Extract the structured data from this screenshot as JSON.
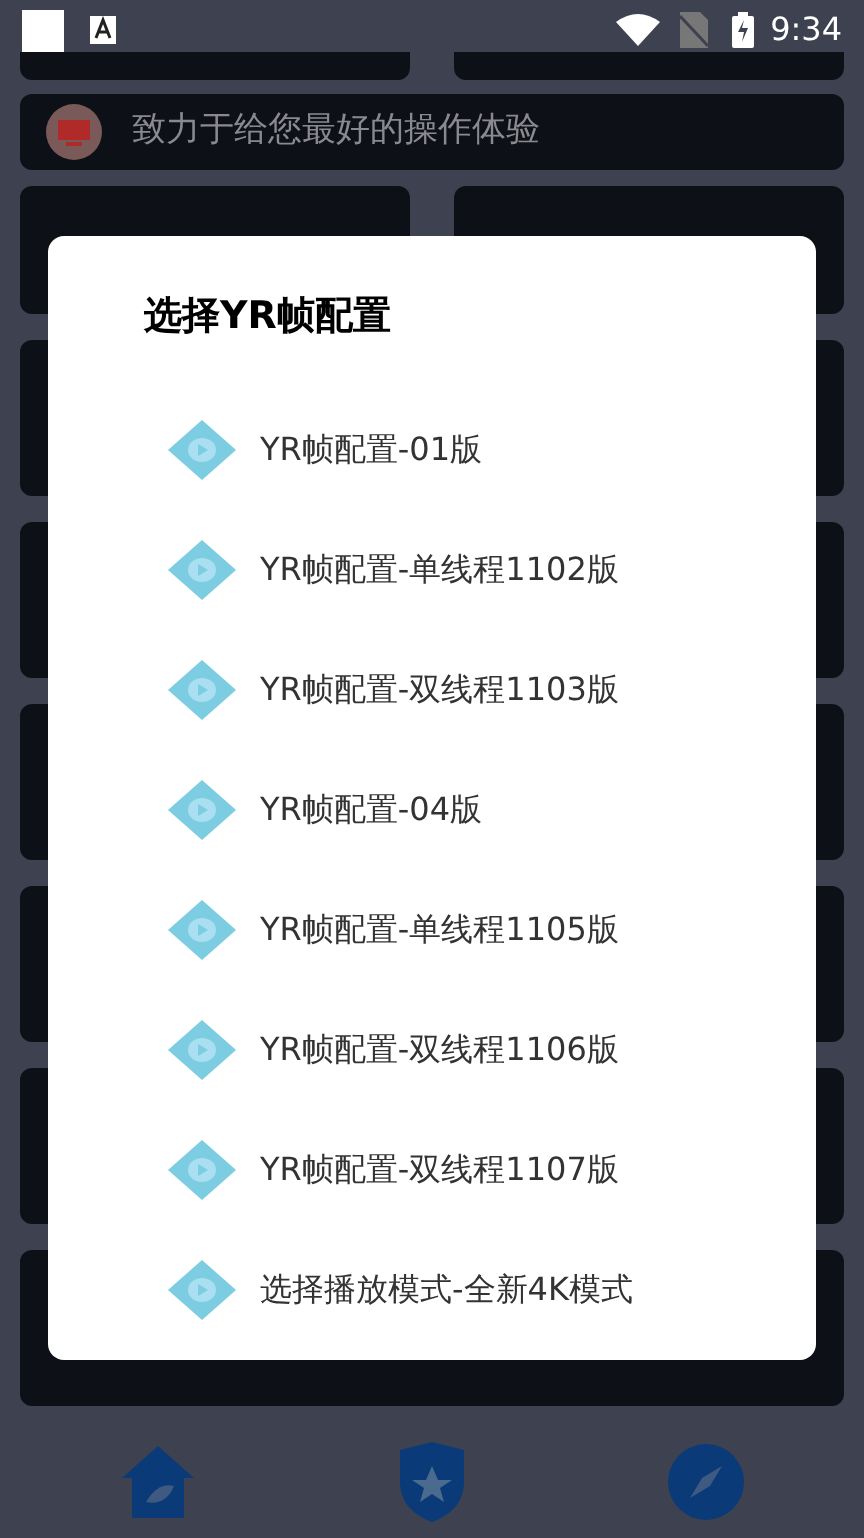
{
  "status_bar": {
    "time": "9:34"
  },
  "banner": {
    "text": "致力于给您最好的操作体验"
  },
  "dialog": {
    "title": "选择YR帧配置",
    "options": [
      {
        "label": "YR帧配置-01版"
      },
      {
        "label": "YR帧配置-单线程1102版"
      },
      {
        "label": "YR帧配置-双线程1103版"
      },
      {
        "label": "YR帧配置-04版"
      },
      {
        "label": "YR帧配置-单线程1105版"
      },
      {
        "label": "YR帧配置-双线程1106版"
      },
      {
        "label": "YR帧配置-双线程1107版"
      },
      {
        "label": "选择播放模式-全新4K模式"
      }
    ]
  }
}
